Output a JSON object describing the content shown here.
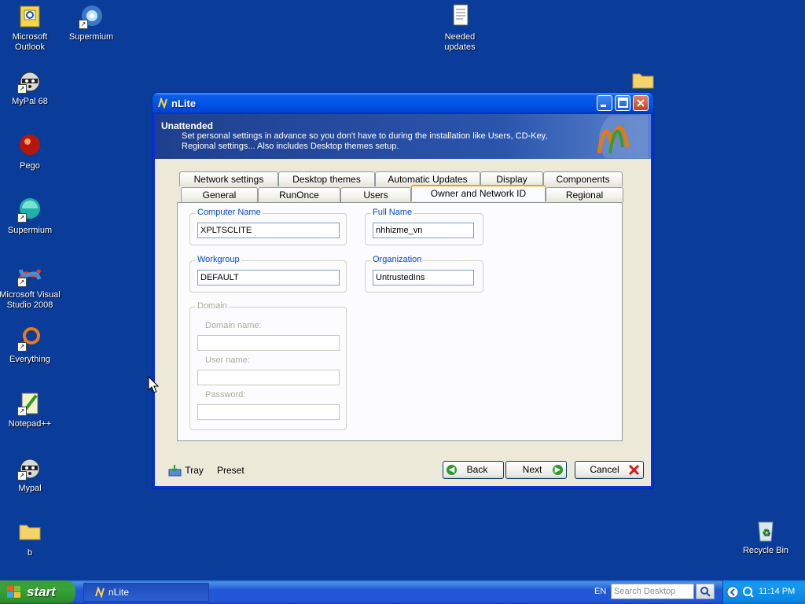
{
  "desktop": {
    "icons": [
      {
        "label": "Microsoft Outlook"
      },
      {
        "label": "Supermium"
      },
      {
        "label": "Needed updates"
      },
      {
        "label": "MyPal 68"
      },
      {
        "label": "Pego"
      },
      {
        "label": "Supermium"
      },
      {
        "label": "Microsoft Visual Studio 2008"
      },
      {
        "label": "Everything"
      },
      {
        "label": "Notepad++"
      },
      {
        "label": "Mypal"
      },
      {
        "label": "b"
      },
      {
        "label": "Recycle Bin"
      }
    ]
  },
  "window": {
    "title": "nLite",
    "banner_heading": "Unattended",
    "banner_description": "Set personal settings in advance so you don't have to during the installation like Users, CD-Key, Regional settings... Also includes Desktop themes setup.",
    "tabs_row1": [
      "Network settings",
      "Desktop themes",
      "Automatic Updates",
      "Display",
      "Components"
    ],
    "tabs_row2": [
      "General",
      "RunOnce",
      "Users",
      "Owner and Network ID",
      "Regional"
    ],
    "active_tab": "Owner and Network ID",
    "groups": {
      "computer_name": {
        "label": "Computer Name",
        "value": "XPLTSCLITE"
      },
      "full_name": {
        "label": "Full Name",
        "value": "nhhizme_vn"
      },
      "workgroup": {
        "label": "Workgroup",
        "value": "DEFAULT"
      },
      "organization": {
        "label": "Organization",
        "value": "UntrustedIns"
      },
      "domain": {
        "label": "Domain",
        "domain_name_label": "Domain name:",
        "user_name_label": "User name:",
        "password_label": "Password:"
      }
    },
    "footer": {
      "tray_label": "Tray",
      "preset_label": "Preset",
      "back_label": "Back",
      "next_label": "Next",
      "cancel_label": "Cancel"
    }
  },
  "taskbar": {
    "start_label": "start",
    "task_label": "nLite",
    "language": "EN",
    "search_placeholder": "Search Desktop",
    "clock": "11:14 PM"
  }
}
